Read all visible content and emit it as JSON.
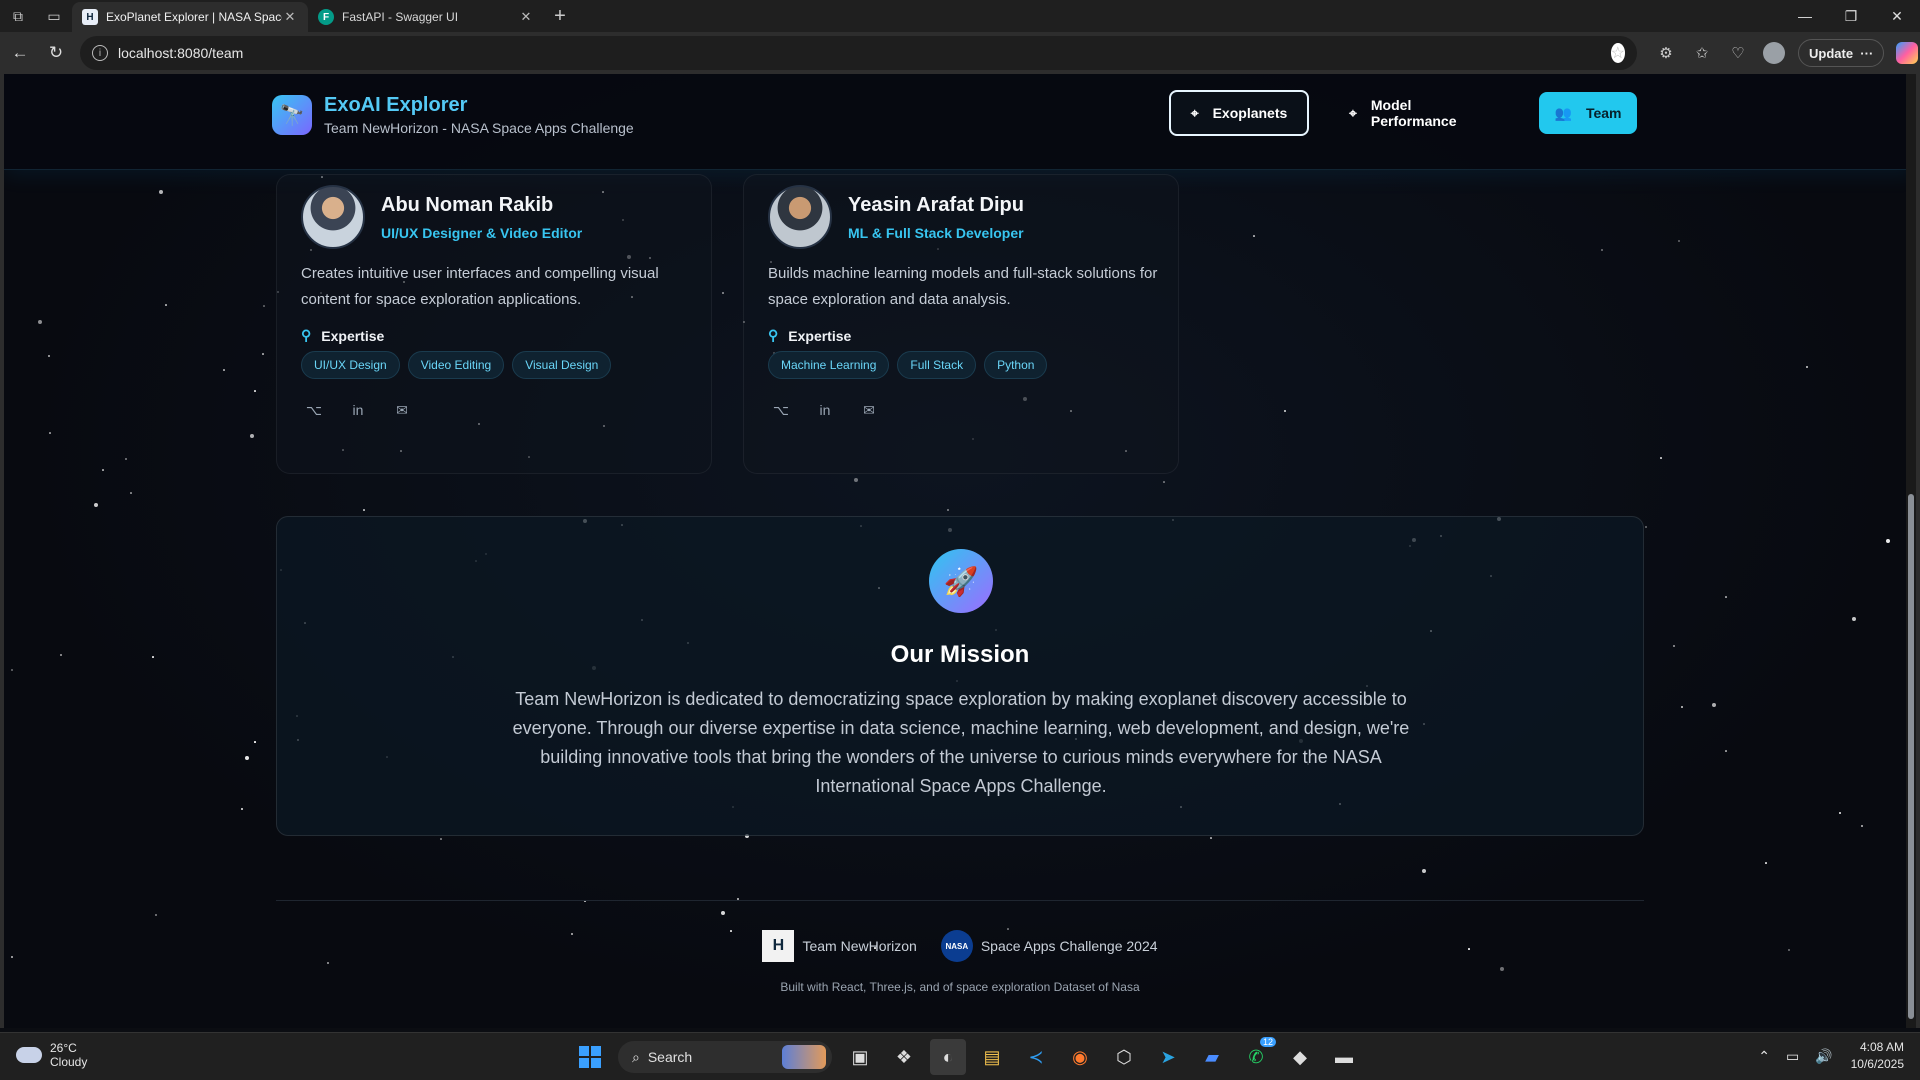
{
  "browser": {
    "tabs": [
      {
        "title": "ExoPlanet Explorer | NASA Space",
        "favicon": "H",
        "active": true
      },
      {
        "title": "FastAPI - Swagger UI",
        "favicon": "F",
        "active": false
      }
    ],
    "url": "localhost:8080/team",
    "update_label": "Update"
  },
  "header": {
    "app_name": "ExoAI Explorer",
    "subtitle": "Team NewHorizon - NASA Space Apps Challenge",
    "nav": [
      {
        "label": "Exoplanets",
        "icon": "telescope-icon"
      },
      {
        "label": "Model Performance",
        "icon": "telescope-icon"
      },
      {
        "label": "Team",
        "icon": "users-icon"
      }
    ]
  },
  "members": [
    {
      "name": "Abu Noman Rakib",
      "role": "UI/UX Designer & Video Editor",
      "description": "Creates intuitive user interfaces and compelling visual content for space exploration applications.",
      "expertise_label": "Expertise",
      "tags": [
        "UI/UX Design",
        "Video Editing",
        "Visual Design"
      ]
    },
    {
      "name": "Yeasin Arafat Dipu",
      "role": "ML & Full Stack Developer",
      "description": "Builds machine learning models and full-stack solutions for space exploration and data analysis.",
      "expertise_label": "Expertise",
      "tags": [
        "Machine Learning",
        "Full Stack",
        "Python"
      ]
    }
  ],
  "mission": {
    "title": "Our Mission",
    "text": "Team NewHorizon is dedicated to democratizing space exploration by making exoplanet discovery accessible to everyone. Through our diverse expertise in data science, machine learning, web development, and design, we're building innovative tools that bring the wonders of the universe to curious minds everywhere for the NASA International Space Apps Challenge."
  },
  "footer": {
    "team_label": "Team NewHorizon",
    "challenge_label": "Space Apps Challenge 2024",
    "note": "Built with React, Three.js, and of space exploration Dataset of Nasa",
    "nasa_logo_text": "NASA"
  },
  "taskbar": {
    "weather_temp": "26°C",
    "weather_desc": "Cloudy",
    "search_label": "Search",
    "whatsapp_badge": "12",
    "time": "4:08 AM",
    "date": "10/6/2025"
  },
  "colors": {
    "accent": "#22c8ee",
    "accent_text": "#38c5f0",
    "mission_icon": "#9d6bff"
  }
}
